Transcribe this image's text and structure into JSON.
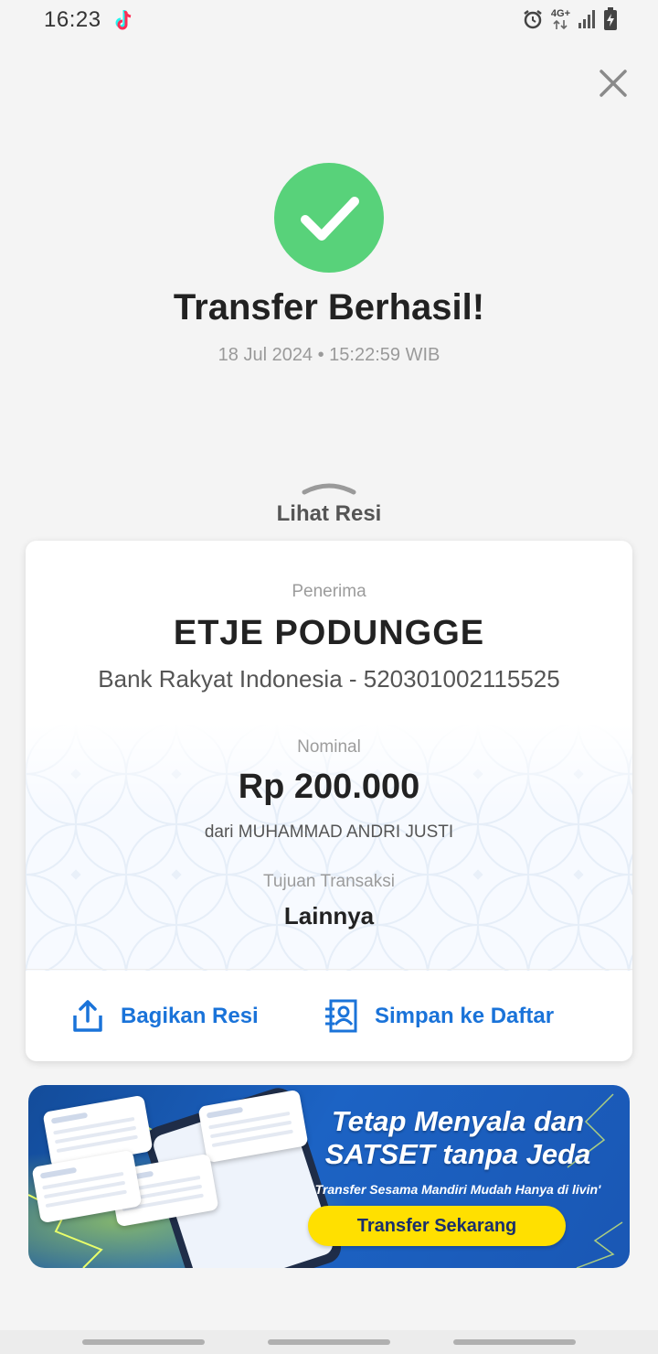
{
  "status_bar": {
    "time": "16:23",
    "network_type": "4G+",
    "icons": [
      "tiktok-icon",
      "alarm-icon",
      "signal-icon",
      "battery-charging-icon"
    ]
  },
  "header": {
    "close_icon": "close-icon"
  },
  "result": {
    "title": "Transfer Berhasil!",
    "datetime": "18 Jul 2024 • 15:22:59 WIB",
    "status_color": "#58d27a"
  },
  "receipt_toggle": {
    "label": "Lihat Resi"
  },
  "receipt": {
    "recipient_label": "Penerima",
    "recipient_name": "ETJE PODUNGGE",
    "recipient_bank": "Bank Rakyat Indonesia - 520301002115525",
    "amount_label": "Nominal",
    "amount": "Rp 200.000",
    "sender": "dari MUHAMMAD ANDRI JUSTI",
    "purpose_label": "Tujuan Transaksi",
    "purpose": "Lainnya"
  },
  "actions": {
    "share_label": "Bagikan Resi",
    "save_label": "Simpan ke Daftar",
    "accent_color": "#1a73d9"
  },
  "promo": {
    "headline": "Tetap Menyala dan SATSET tanpa Jeda",
    "subtext": "Transfer Sesama Mandiri Mudah Hanya di livin'",
    "cta_label": "Transfer Sekarang",
    "cta_color": "#ffe000"
  }
}
